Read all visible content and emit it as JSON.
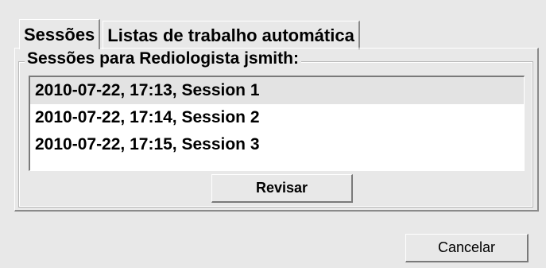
{
  "tabs": [
    {
      "label": "Sessões",
      "active": true
    },
    {
      "label": "Listas de trabalho automática",
      "active": false
    }
  ],
  "sessions": {
    "group_title": "Sessões para Rediologista jsmith:",
    "items": [
      {
        "label": "2010-07-22, 17:13, Session 1",
        "selected": true
      },
      {
        "label": "2010-07-22, 17:14, Session 2",
        "selected": false
      },
      {
        "label": "2010-07-22, 17:15, Session 3",
        "selected": false
      }
    ],
    "review_label": "Revisar"
  },
  "footer": {
    "cancel_label": "Cancelar"
  }
}
